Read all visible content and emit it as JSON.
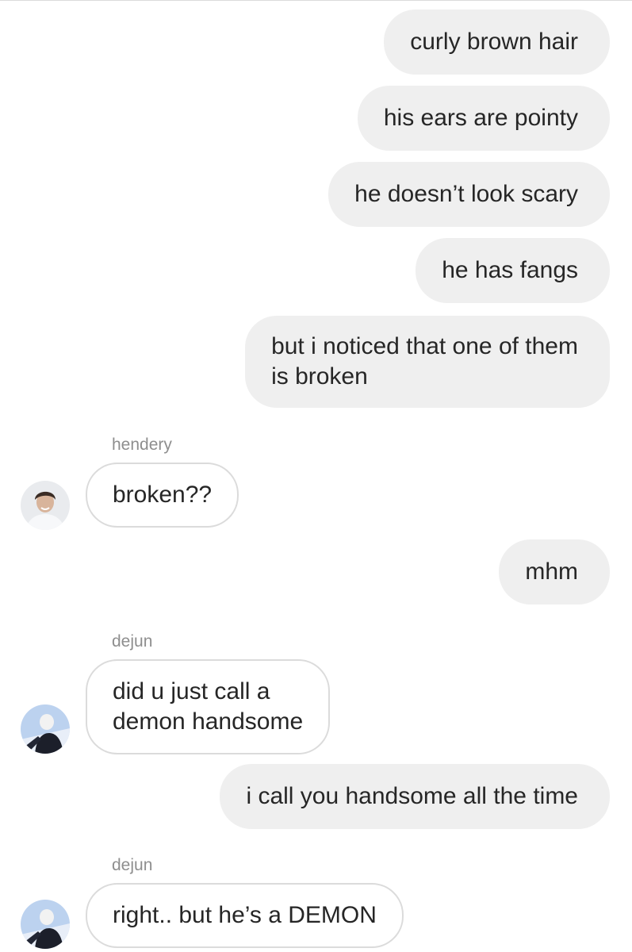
{
  "messages": [
    {
      "direction": "outgoing",
      "text": "curly brown hair"
    },
    {
      "direction": "outgoing",
      "text": "his ears are pointy"
    },
    {
      "direction": "outgoing",
      "text": "he doesn’t look scary"
    },
    {
      "direction": "outgoing",
      "text": "he has fangs"
    },
    {
      "direction": "outgoing",
      "lines": [
        "but i noticed that one of them",
        "is broken"
      ]
    },
    {
      "direction": "incoming",
      "sender": "hendery",
      "text": "broken??"
    },
    {
      "direction": "outgoing",
      "text": "mhm"
    },
    {
      "direction": "incoming",
      "sender": "dejun",
      "lines": [
        "did u just call a",
        "demon handsome"
      ]
    },
    {
      "direction": "outgoing",
      "text": "i call you handsome all the time"
    },
    {
      "direction": "incoming",
      "sender": "dejun",
      "text": "right.. but he’s a DEMON"
    }
  ],
  "colors": {
    "outgoing_bubble": "#efefef",
    "incoming_border": "#dbdbdb",
    "text": "#262626",
    "sender_name": "#8e8e8e"
  },
  "avatars": {
    "hendery": "avatar-photo-light",
    "dejun": "avatar-photo-blue"
  }
}
